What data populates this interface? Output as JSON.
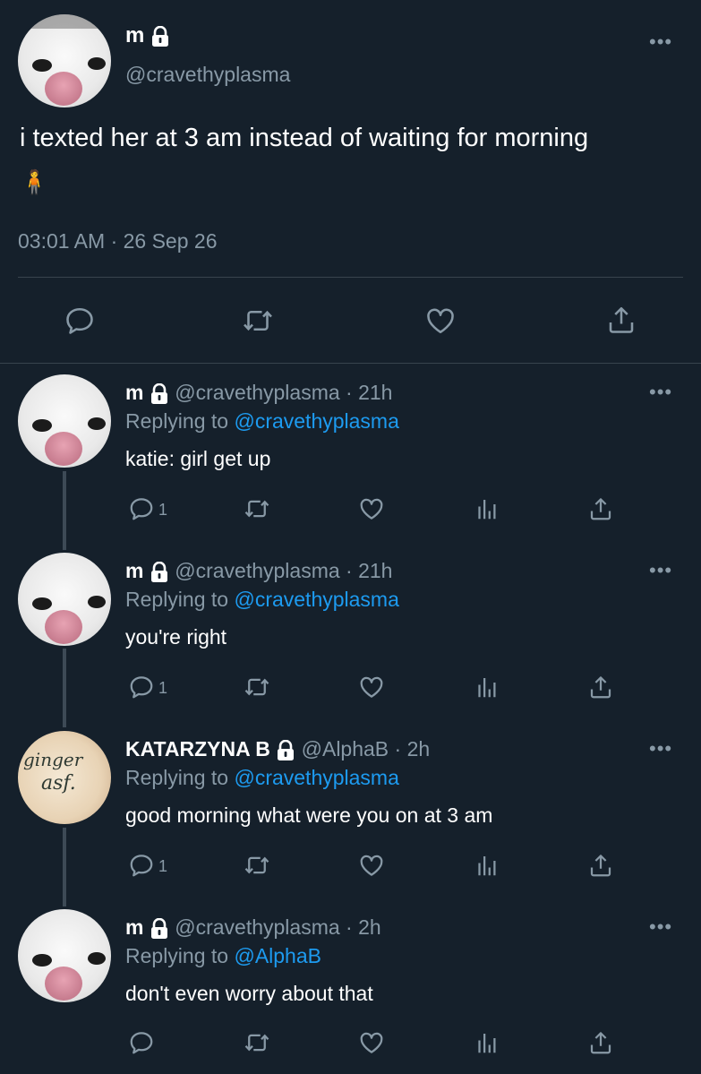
{
  "main_tweet": {
    "display_name": "m",
    "handle": "@cravethyplasma",
    "text": "i texted her at 3 am instead of waiting for morning",
    "emoji": "🧍",
    "timestamp": "03:01 AM · 26 Sep 26",
    "more_label": "•••"
  },
  "replies": [
    {
      "display_name": "m",
      "handle": "@cravethyplasma",
      "time": "· 21h",
      "replying_prefix": "Replying to",
      "replying_to": "@cravethyplasma",
      "text": "katie: girl get up",
      "reply_count": "1",
      "more_label": "•••"
    },
    {
      "display_name": "m",
      "handle": "@cravethyplasma",
      "time": "· 21h",
      "replying_prefix": "Replying to",
      "replying_to": "@cravethyplasma",
      "text": "you're right",
      "reply_count": "1",
      "more_label": "•••"
    },
    {
      "display_name": "KATARZYNA B",
      "handle": "@AlphaB",
      "time": "· 2h",
      "replying_prefix": "Replying to",
      "replying_to": "@cravethyplasma",
      "text": "good morning what were you on at 3 am",
      "reply_count": "1",
      "more_label": "•••",
      "avatar_text_1": "ginger",
      "avatar_text_2": "asf."
    },
    {
      "display_name": "m",
      "handle": "@cravethyplasma",
      "time": "· 2h",
      "replying_prefix": "Replying to",
      "replying_to": "@AlphaB",
      "text": "don't even worry about that",
      "reply_count": "",
      "more_label": "•••"
    }
  ],
  "colors": {
    "background": "#15202b",
    "muted": "#8899a6",
    "link": "#1d9bf0",
    "divider": "#38444d"
  },
  "icons": [
    "reply-icon",
    "retweet-icon",
    "like-icon",
    "analytics-icon",
    "share-icon",
    "lock-icon",
    "more-icon"
  ]
}
